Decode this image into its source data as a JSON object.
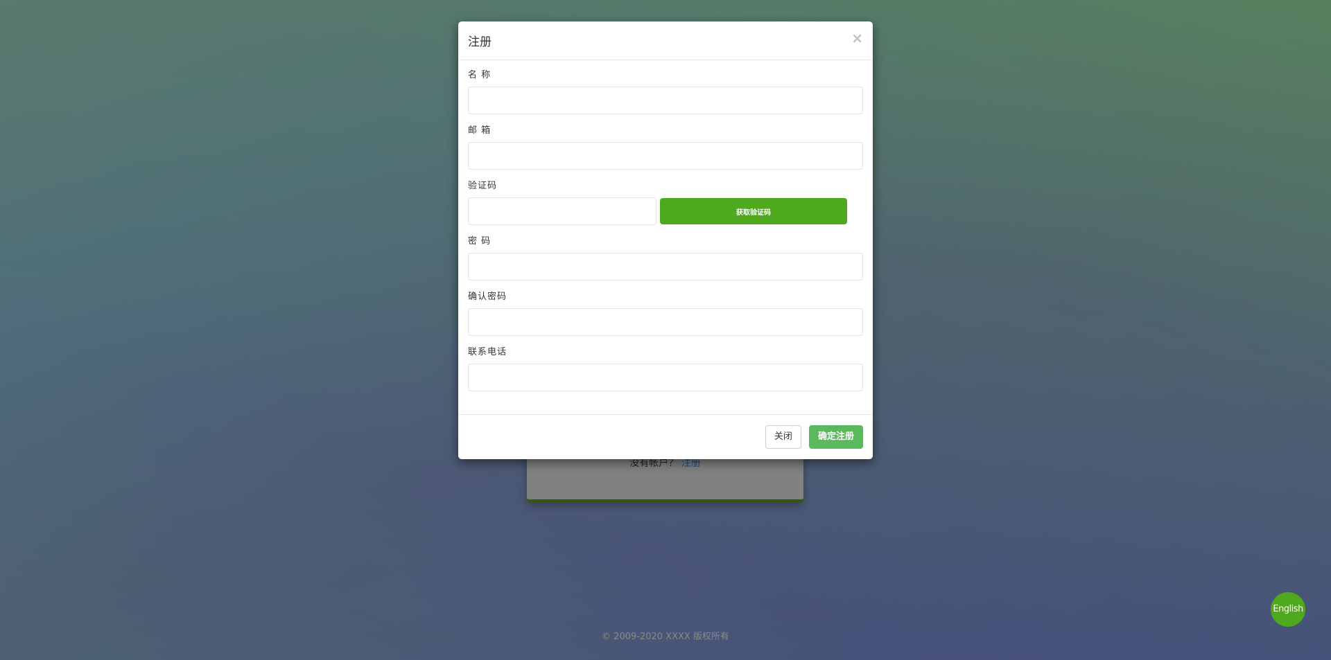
{
  "background_login": {
    "no_account": "没有帐户？",
    "register_link": "注册"
  },
  "modal": {
    "title": "注册",
    "close_icon": "×",
    "fields": [
      {
        "label": "名 称",
        "value": ""
      },
      {
        "label": "邮 箱",
        "value": ""
      },
      {
        "label": "验证码",
        "value": ""
      },
      {
        "label": "密 码",
        "value": ""
      },
      {
        "label": "确认密码",
        "value": ""
      },
      {
        "label": "联系电话",
        "value": ""
      }
    ],
    "get_code_button": "获取验证码",
    "close_button": "关闭",
    "confirm_button": "确定注册"
  },
  "footer": {
    "copyright": "© 2009-2020 XXXX 版权所有"
  },
  "language_button": "English",
  "colors": {
    "accent": "#4fa91f",
    "confirm": "#5cb85c"
  }
}
